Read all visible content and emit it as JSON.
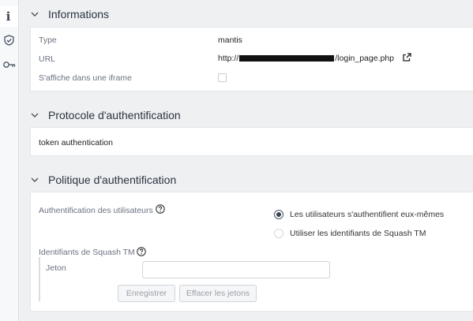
{
  "sidebar": {
    "items": [
      {
        "icon": "info-icon",
        "active": true
      },
      {
        "icon": "shield-icon",
        "active": false
      },
      {
        "icon": "key-icon",
        "active": false
      }
    ]
  },
  "informations": {
    "title": "Informations",
    "type_label": "Type",
    "type_value": "mantis",
    "url_label": "URL",
    "url_prefix": "http://",
    "url_suffix": "/login_page.php",
    "iframe_label": "S'affiche dans une iframe",
    "iframe_checked": false
  },
  "protocol": {
    "title": "Protocole d'authentification",
    "value": "token authentication"
  },
  "policy": {
    "title": "Politique d'authentification",
    "users_auth_label": "Authentification des utilisateurs",
    "option_self": "Les utilisateurs s'authentifient eux-mêmes",
    "option_squash": "Utiliser les identifiants de Squash TM",
    "selected": "option_self",
    "squash_creds_label": "Identifiants de Squash TM",
    "token_label": "Jeton",
    "token_value": "",
    "save_label": "Enregistrer",
    "clear_label": "Effacer les jetons"
  },
  "colors": {
    "background": "#eef0f2",
    "card": "#ffffff",
    "title": "#2c3440",
    "label": "#6b7280"
  }
}
